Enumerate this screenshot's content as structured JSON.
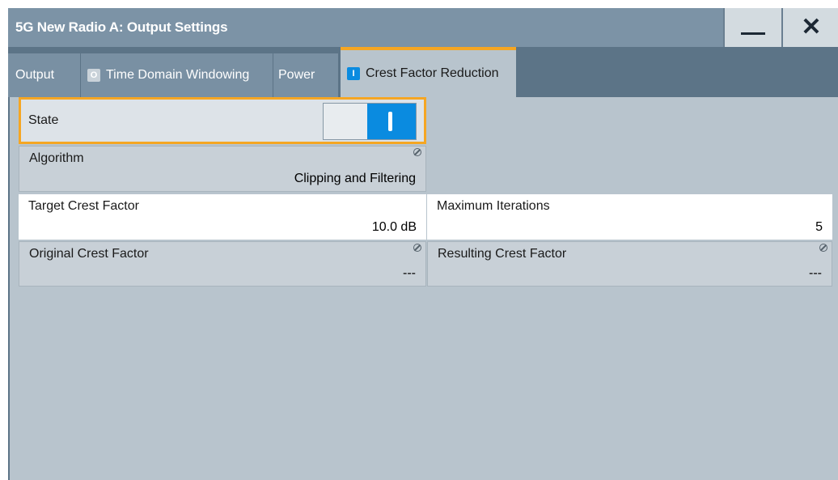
{
  "window": {
    "title": "5G New Radio A: Output Settings",
    "minimize_label": "—",
    "close_label": "✕"
  },
  "tabs": [
    {
      "label": "Output",
      "indicator": ""
    },
    {
      "label": "Time Domain Windowing",
      "indicator": "O"
    },
    {
      "label": "Power",
      "indicator": ""
    },
    {
      "label": "Crest Factor Reduction",
      "indicator": "I"
    }
  ],
  "fields": {
    "state": {
      "label": "State",
      "value": "on"
    },
    "algorithm": {
      "label": "Algorithm",
      "value": "Clipping and Filtering"
    },
    "target_crest_factor": {
      "label": "Target Crest Factor",
      "value": "10.0 dB"
    },
    "maximum_iterations": {
      "label": "Maximum Iterations",
      "value": "5"
    },
    "original_crest_factor": {
      "label": "Original Crest Factor",
      "value": "---"
    },
    "resulting_crest_factor": {
      "label": "Resulting Crest Factor",
      "value": "---"
    }
  },
  "colors": {
    "accent": "#f5a623",
    "active_blue": "#0a8be0",
    "titlebar": "#7c93a6",
    "panel": "#b8c4cd"
  }
}
